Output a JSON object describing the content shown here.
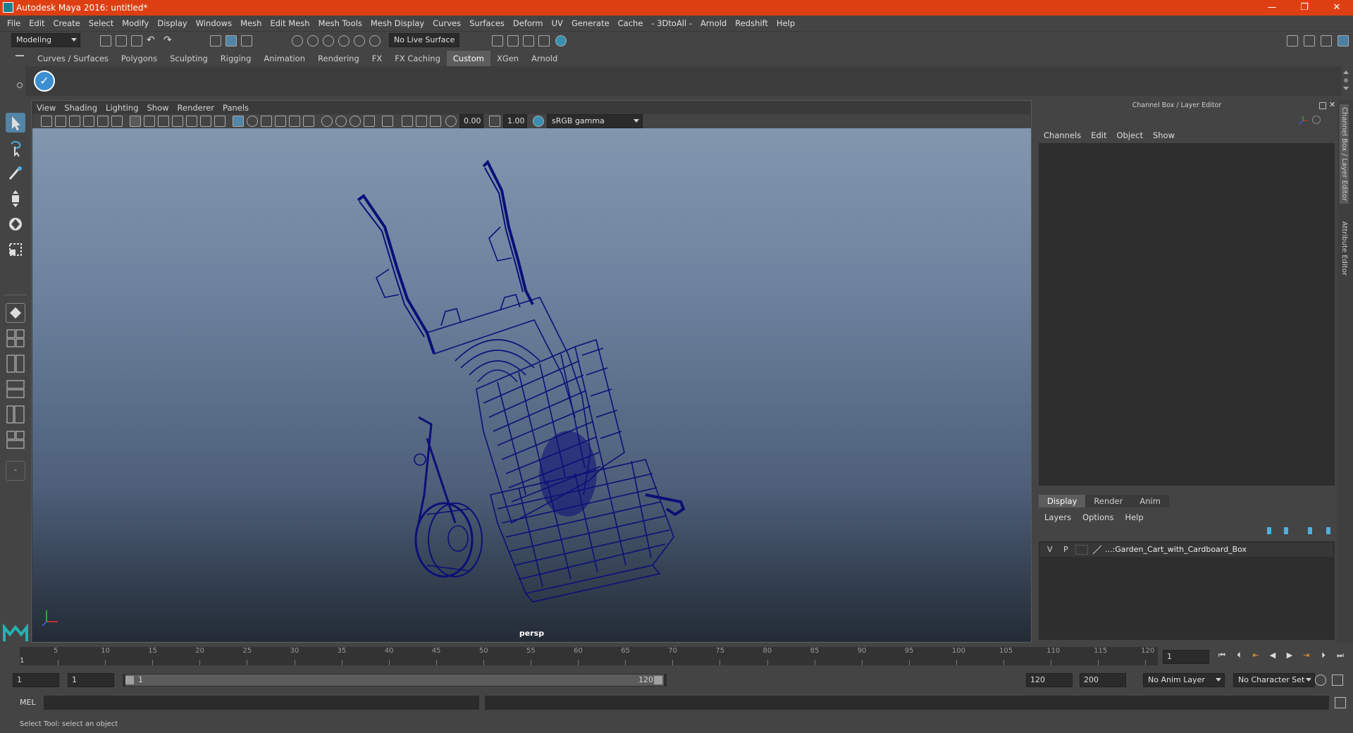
{
  "window": {
    "title": "Autodesk Maya 2016: untitled*",
    "minimize": "—",
    "restore": "❐",
    "close": "✕"
  },
  "menubar": [
    "File",
    "Edit",
    "Create",
    "Select",
    "Modify",
    "Display",
    "Windows",
    "Mesh",
    "Edit Mesh",
    "Mesh Tools",
    "Mesh Display",
    "Curves",
    "Surfaces",
    "Deform",
    "UV",
    "Generate",
    "Cache",
    "- 3DtoAll -",
    "Arnold",
    "Redshift",
    "Help"
  ],
  "statusline": {
    "mode": "Modeling",
    "live_surface": "No Live Surface"
  },
  "shelf_tabs": [
    "Curves / Surfaces",
    "Polygons",
    "Sculpting",
    "Rigging",
    "Animation",
    "Rendering",
    "FX",
    "FX Caching",
    "Custom",
    "XGen",
    "Arnold"
  ],
  "shelf_active_tab": "Custom",
  "viewport": {
    "menu": [
      "View",
      "Shading",
      "Lighting",
      "Show",
      "Renderer",
      "Panels"
    ],
    "exposure": "0.00",
    "gamma": "1.00",
    "color_space": "sRGB gamma",
    "camera_label": "persp",
    "wire_color": "#0b0f78"
  },
  "channelbox": {
    "title": "Channel Box / Layer Editor",
    "menu": [
      "Channels",
      "Edit",
      "Object",
      "Show"
    ]
  },
  "layer_editor": {
    "tabs": [
      "Display",
      "Render",
      "Anim"
    ],
    "active_tab": "Display",
    "menu": [
      "Layers",
      "Options",
      "Help"
    ],
    "layer": {
      "v": "V",
      "p": "P",
      "name": "...:Garden_Cart_with_Cardboard_Box"
    }
  },
  "side_tabs": {
    "channel_box": "Channel Box / Layer Editor",
    "attribute_editor": "Attribute Editor"
  },
  "timeslider": {
    "ticks": [
      "5",
      "10",
      "15",
      "20",
      "25",
      "30",
      "35",
      "40",
      "45",
      "50",
      "55",
      "60",
      "65",
      "70",
      "75",
      "80",
      "85",
      "90",
      "95",
      "100",
      "105",
      "110",
      "115",
      "120"
    ],
    "start_marker": "1",
    "current_frame": "1"
  },
  "range": {
    "start": "1",
    "playback_start": "1",
    "slider_start": "1",
    "slider_end": "120",
    "playback_end": "120",
    "end": "200",
    "anim_layer": "No Anim Layer",
    "character_set": "No Character Set"
  },
  "cmdline": {
    "label": "MEL"
  },
  "helpline": {
    "text": "Select Tool: select an object"
  }
}
